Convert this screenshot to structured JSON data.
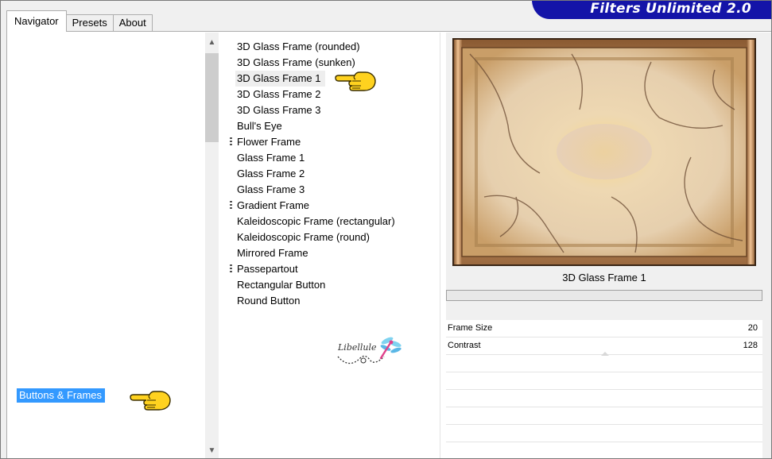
{
  "app": {
    "title": "Filters Unlimited 2.0"
  },
  "tabs": [
    {
      "label": "Navigator",
      "active": true
    },
    {
      "label": "Presets",
      "active": false
    },
    {
      "label": "About",
      "active": false
    }
  ],
  "categories": {
    "selected": "Buttons & Frames"
  },
  "filters": [
    {
      "label": "3D Glass Frame (rounded)",
      "group": false,
      "selected": false
    },
    {
      "label": "3D Glass Frame (sunken)",
      "group": false,
      "selected": false
    },
    {
      "label": "3D Glass Frame 1",
      "group": false,
      "selected": true
    },
    {
      "label": "3D Glass Frame 2",
      "group": false,
      "selected": false
    },
    {
      "label": "3D Glass Frame 3",
      "group": false,
      "selected": false
    },
    {
      "label": "Bull's Eye",
      "group": false,
      "selected": false
    },
    {
      "label": "Flower Frame",
      "group": true,
      "selected": false
    },
    {
      "label": "Glass Frame 1",
      "group": false,
      "selected": false
    },
    {
      "label": "Glass Frame 2",
      "group": false,
      "selected": false
    },
    {
      "label": "Glass Frame 3",
      "group": false,
      "selected": false
    },
    {
      "label": "Gradient Frame",
      "group": true,
      "selected": false
    },
    {
      "label": "Kaleidoscopic Frame (rectangular)",
      "group": false,
      "selected": false
    },
    {
      "label": "Kaleidoscopic Frame (round)",
      "group": false,
      "selected": false
    },
    {
      "label": "Mirrored Frame",
      "group": false,
      "selected": false
    },
    {
      "label": "Passepartout",
      "group": true,
      "selected": false
    },
    {
      "label": "Rectangular Button",
      "group": false,
      "selected": false
    },
    {
      "label": "Round Button",
      "group": false,
      "selected": false
    }
  ],
  "logo": {
    "text": "Libellule"
  },
  "preview": {
    "filter_name": "3D Glass Frame 1"
  },
  "params": [
    {
      "label": "Frame Size",
      "value": "20"
    },
    {
      "label": "Contrast",
      "value": "128"
    }
  ],
  "colors": {
    "banner": "#1414a8",
    "selection": "#3399ff",
    "hand_fill": "#ffd21f"
  },
  "icons": {
    "pointer": "pointing-hand-icon",
    "scroll_up": "chevron-up-icon",
    "scroll_down": "chevron-down-icon"
  }
}
